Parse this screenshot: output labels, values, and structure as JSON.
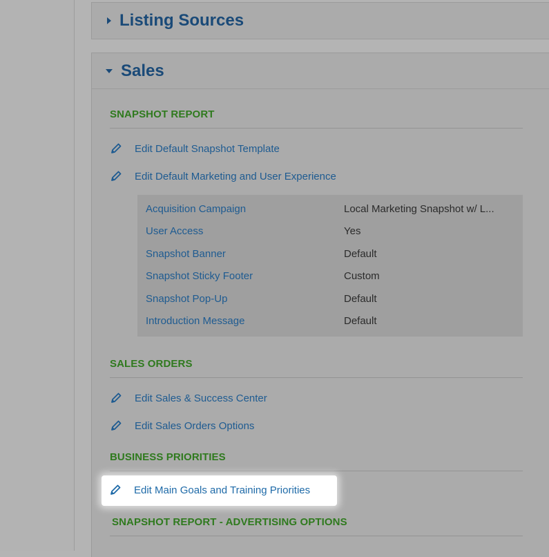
{
  "listing_sources": {
    "title": "Listing Sources"
  },
  "sales": {
    "title": "Sales",
    "snapshot_report": {
      "heading": "SNAPSHOT REPORT",
      "links": [
        "Edit Default Snapshot Template",
        "Edit Default Marketing and User Experience"
      ],
      "details": [
        {
          "key": "Acquisition Campaign",
          "value": "Local Marketing Snapshot w/ L..."
        },
        {
          "key": "User Access",
          "value": "Yes"
        },
        {
          "key": "Snapshot Banner",
          "value": "Default"
        },
        {
          "key": "Snapshot Sticky Footer",
          "value": "Custom"
        },
        {
          "key": "Snapshot Pop-Up",
          "value": "Default"
        },
        {
          "key": "Introduction Message",
          "value": "Default"
        }
      ]
    },
    "sales_orders": {
      "heading": "SALES ORDERS",
      "links": [
        "Edit Sales & Success Center",
        "Edit Sales Orders Options"
      ]
    },
    "business_priorities": {
      "heading": "BUSINESS PRIORITIES",
      "links": [
        "Edit Main Goals and Training Priorities"
      ]
    },
    "advertising_options": {
      "heading": "SNAPSHOT REPORT - ADVERTISING OPTIONS"
    }
  },
  "colors": {
    "link": "#1e5b91",
    "heading_green": "#2f7a1e",
    "panel_title": "#1a4a78"
  },
  "icons": {
    "collapse": "caret-right-icon",
    "expand": "caret-down-icon",
    "edit": "pencil-icon"
  }
}
